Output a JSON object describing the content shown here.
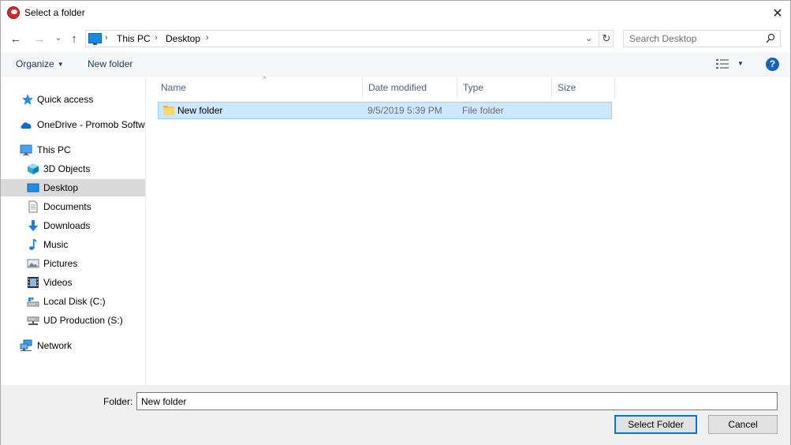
{
  "window": {
    "title": "Select a folder",
    "close_glyph": "✕"
  },
  "nav": {
    "back_glyph": "←",
    "forward_glyph": "→",
    "recent_glyph": "⌄",
    "up_glyph": "↑",
    "breadcrumbs": [
      "This PC",
      "Desktop"
    ],
    "separator": "›",
    "dropdown_glyph": "⌄",
    "refresh_glyph": "↻"
  },
  "search": {
    "placeholder": "Search Desktop"
  },
  "toolbar": {
    "organize_label": "Organize",
    "organize_caret": "▼",
    "new_folder_label": "New folder",
    "view_caret": "▼",
    "help_glyph": "?"
  },
  "sidebar": {
    "items": [
      {
        "label": "Quick access",
        "icon": "star-icon"
      },
      {
        "label": "OneDrive - Promob Software",
        "icon": "cloud-icon"
      },
      {
        "label": "This PC",
        "icon": "monitor-icon"
      },
      {
        "label": "3D Objects",
        "icon": "cube-icon"
      },
      {
        "label": "Desktop",
        "icon": "desktop-icon",
        "selected": true
      },
      {
        "label": "Documents",
        "icon": "document-icon"
      },
      {
        "label": "Downloads",
        "icon": "download-icon"
      },
      {
        "label": "Music",
        "icon": "music-icon"
      },
      {
        "label": "Pictures",
        "icon": "picture-icon"
      },
      {
        "label": "Videos",
        "icon": "video-icon"
      },
      {
        "label": "Local Disk (C:)",
        "icon": "drive-icon"
      },
      {
        "label": "UD Production (S:)",
        "icon": "network-drive-icon"
      },
      {
        "label": "Network",
        "icon": "network-icon"
      }
    ]
  },
  "table": {
    "sort_glyph": "^",
    "columns": [
      "Name",
      "Date modified",
      "Type",
      "Size"
    ],
    "rows": [
      {
        "name": "New folder",
        "date": "9/5/2019 5:39 PM",
        "type": "File folder",
        "size": ""
      }
    ]
  },
  "footer": {
    "folder_label": "Folder:",
    "folder_value": "New folder",
    "select_button": "Select Folder",
    "cancel_button": "Cancel"
  },
  "colors": {
    "accent": "#0078d7",
    "selection": "#cce8ff",
    "selection_border": "#99d1ff",
    "nav_selected": "#d9d9d9"
  }
}
